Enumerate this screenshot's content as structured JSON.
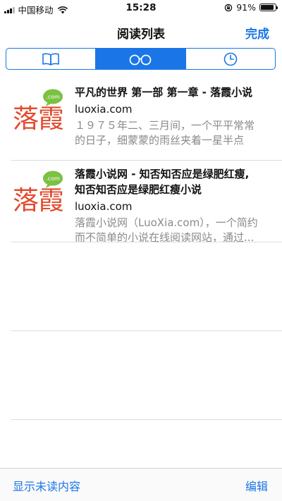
{
  "status_bar": {
    "carrier": "中国移动",
    "time": "15:28",
    "battery_text": "91%",
    "battery_level": 0.91,
    "icons": [
      "signal-icon",
      "wifi-icon",
      "rotation-lock-icon",
      "battery-icon"
    ]
  },
  "nav": {
    "title": "阅读列表",
    "done_label": "完成"
  },
  "segmented": {
    "segments": [
      {
        "icon": "book-icon",
        "selected": false
      },
      {
        "icon": "glasses-icon",
        "selected": true
      },
      {
        "icon": "clock-icon",
        "selected": false
      }
    ]
  },
  "items": [
    {
      "logo_text": "落霞",
      "logo_badge": ".com",
      "title_line1": "平凡的世界 第一部 第一章 - 落霞小说",
      "title_line2": "",
      "domain": "luoxia.com",
      "snippet_line1": "１９７５年二、三月间，一个平平常常",
      "snippet_line2": "的日子，细蒙蒙的雨丝夹着一星半点"
    },
    {
      "logo_text": "落霞",
      "logo_badge": ".com",
      "title_line1": "落霞小说网 - 知否知否应是绿肥红瘦,",
      "title_line2": "知否知否应是绿肥红瘦小说",
      "domain": "luoxia.com",
      "snippet_line1": "落霞小说网（LuoXia.com），一个简约",
      "snippet_line2": "而不简单的小说在线阅读网站，通过..."
    }
  ],
  "toolbar": {
    "left_label": "显示未读内容",
    "right_label": "编辑"
  },
  "colors": {
    "accent": "#1a76e6",
    "logo_red": "#e24b2f",
    "logo_green": "#7bc142"
  }
}
